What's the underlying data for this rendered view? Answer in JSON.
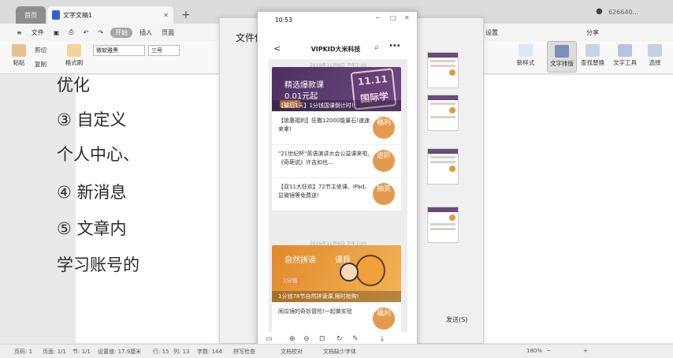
{
  "titlebar": {
    "home_tab": "首页",
    "doc_tab": "文字文稿1",
    "add_tab": "+",
    "user_id": "626640..."
  },
  "menubar": {
    "file": "文件",
    "tool_pill": "开始",
    "insert": "插入",
    "page": "页面",
    "share": "分享"
  },
  "ribbon": {
    "paste": "粘贴",
    "cut": "剪切",
    "copy": "复制",
    "format_painter": "格式刷",
    "font_name": "微软雅黑",
    "font_size": "三号",
    "new_style": "新样式",
    "text_layout": "文字排版",
    "find_replace": "查找替换",
    "text_tools": "文字工具",
    "select": "选择"
  },
  "document": {
    "lines": [
      "优化",
      "③  自定义",
      "个人中心、",
      "④  新消息",
      "⑤  文章内",
      "学习账号的"
    ]
  },
  "dialog": {
    "title": "文件传输",
    "link": "设置",
    "send": "发送(S)"
  },
  "phone": {
    "time": "10:53",
    "title": "VIPKID大米科技",
    "back": "<",
    "timestamp1": "2019年11月8日 下午7:00",
    "timestamp2": "2019年11月9日 下午7:00",
    "card1": {
      "banner_title": "精选爆款课",
      "banner_sub": "0.01元起",
      "banner_big": "11.11 国际学",
      "banner_tag": "1分钱",
      "caption": "【最后1天】1分钱国课倒计时!",
      "items": [
        {
          "text": "【锁惠福利】狂撒12000能量石!速速来拿!",
          "badge": "福利"
        },
        {
          "text": "\"21世纪杯\"英语演讲大会公益课来啦,《奇葩说》许吉如也...",
          "badge": "进阶"
        },
        {
          "text": "【双11大狂欢】72节主修课、iPad、显微镜等免费送!",
          "badge": "抽奖"
        }
      ]
    },
    "card2": {
      "banner_title": "自然拼读",
      "banner_sub": "课程",
      "banner_tag": "1分钱",
      "caption": "1分钱78节自然拼读课,限时抢购!",
      "items": [
        {
          "text": "闹瓜镜的奇妙冒险!一起做实验",
          "badge": "福利"
        }
      ]
    }
  },
  "statusbar": {
    "page": "页码: 1",
    "pages": "页面: 1/1",
    "section": "节: 1/1",
    "position": "设置值: 17.9厘米",
    "line": "行: 15",
    "col": "列: 13",
    "words": "字数: 144",
    "spell": "拼写检查",
    "doc_check": "文档校对",
    "missing_font": "文档缺少字体",
    "zoom": "180%"
  }
}
